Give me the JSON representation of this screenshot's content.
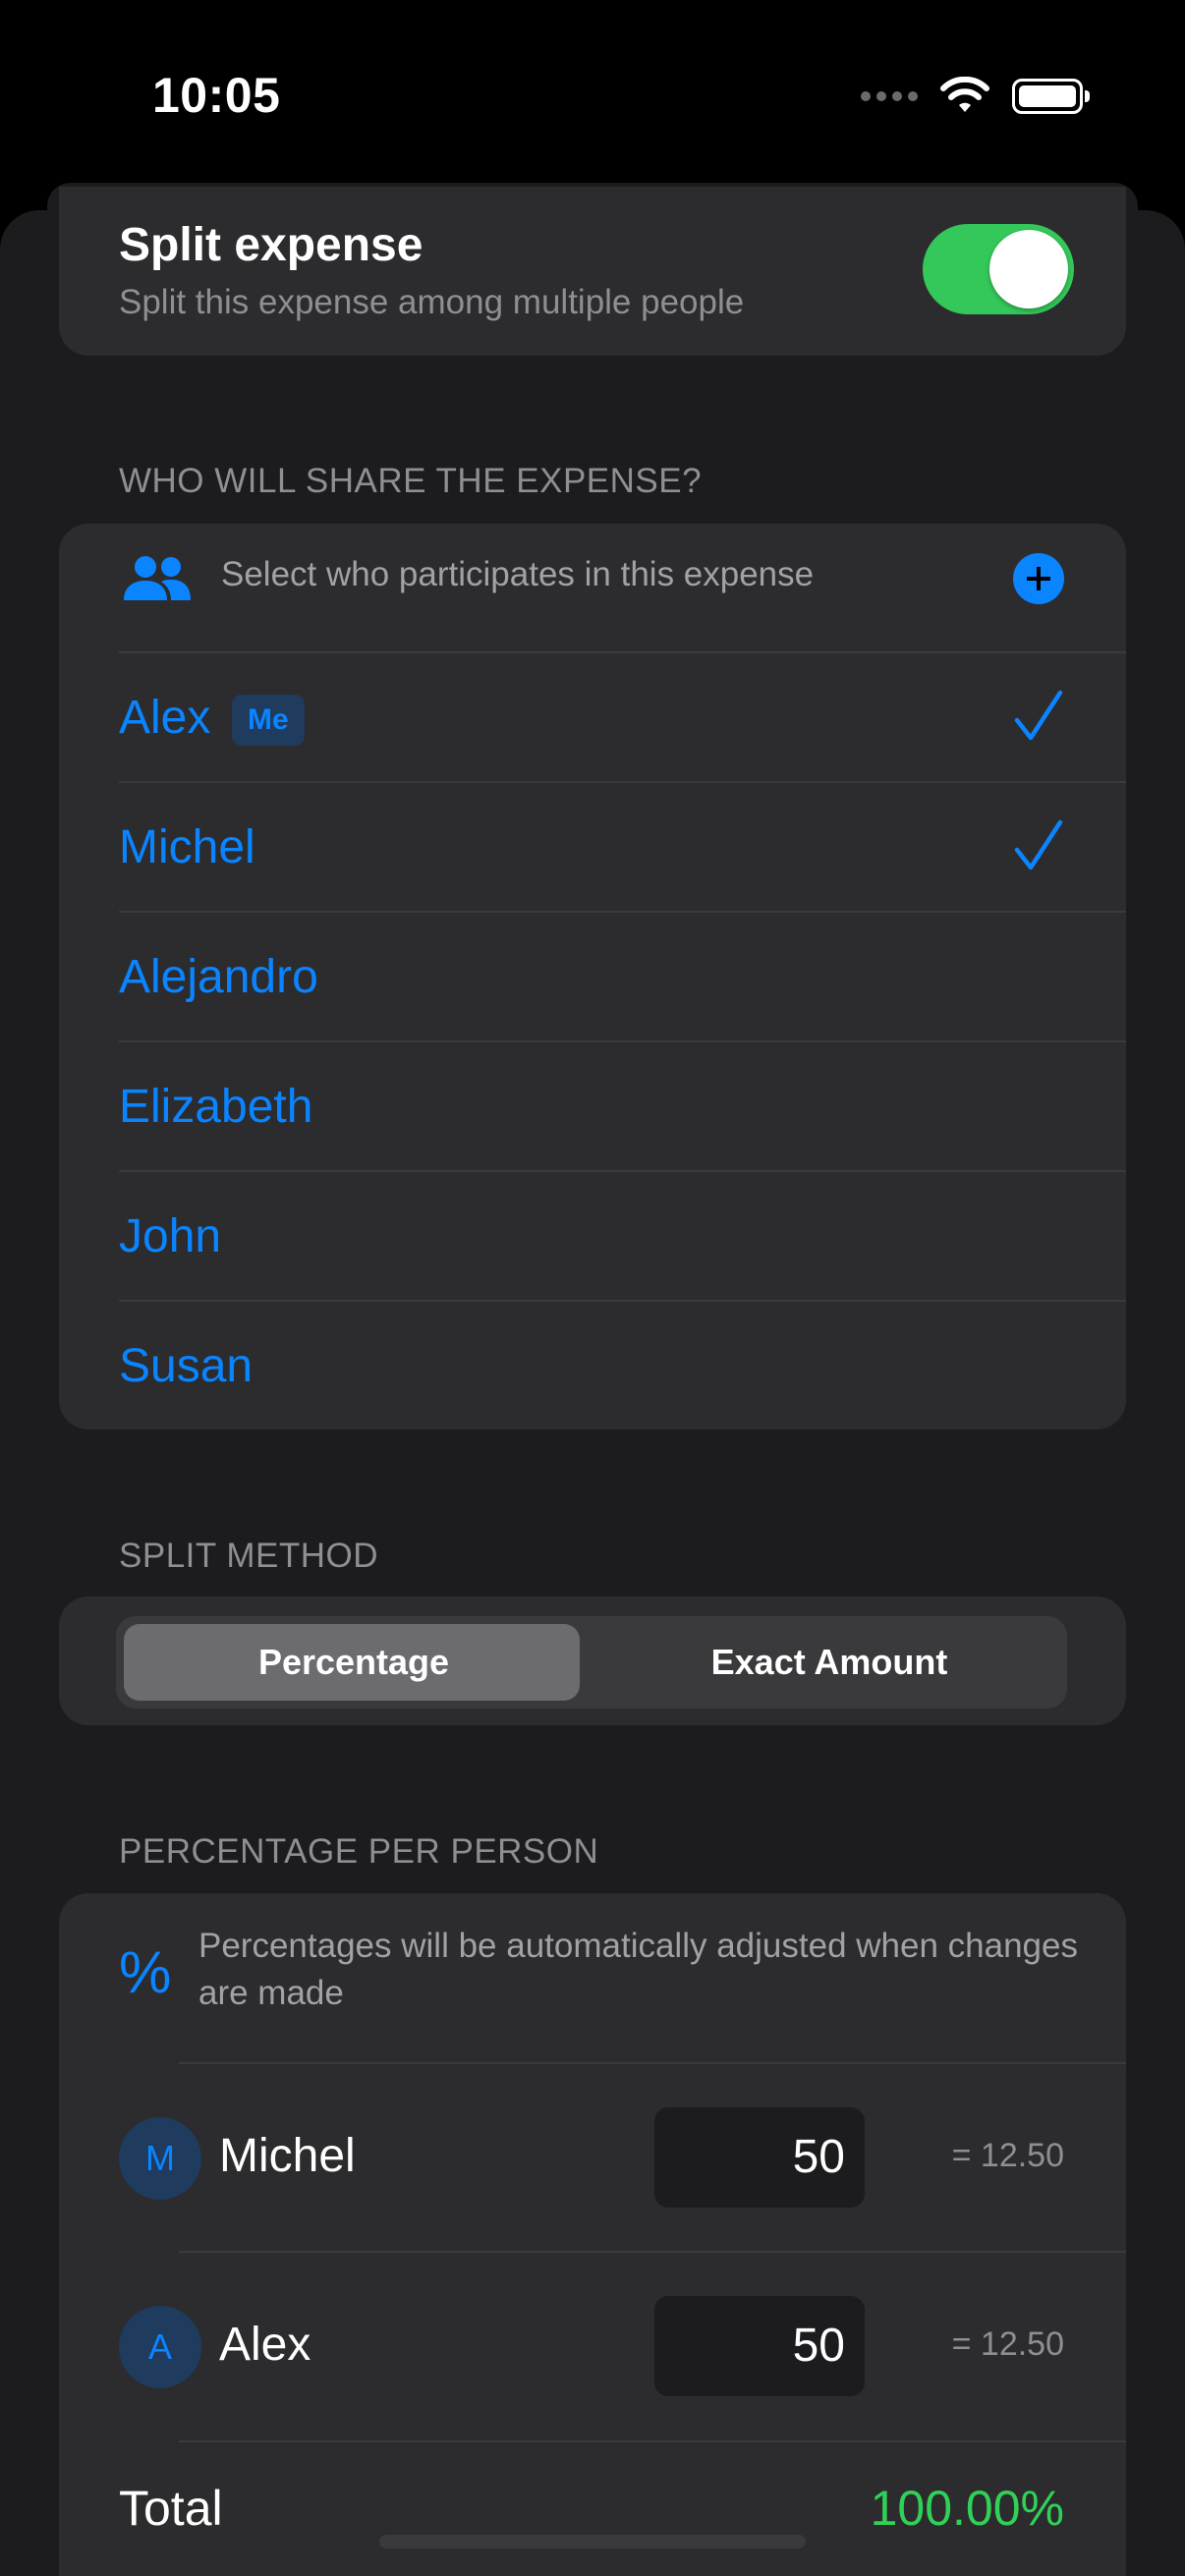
{
  "status_bar": {
    "time": "10:05"
  },
  "split_expense": {
    "title": "Split expense",
    "subtitle": "Split this expense among multiple people",
    "enabled": true
  },
  "share_section": {
    "header": "WHO WILL SHARE THE EXPENSE?",
    "instruction": "Select who participates in this expense",
    "people": [
      {
        "name": "Alex",
        "badge": "Me",
        "selected": true
      },
      {
        "name": "Michel",
        "selected": true
      },
      {
        "name": "Alejandro",
        "selected": false
      },
      {
        "name": "Elizabeth",
        "selected": false
      },
      {
        "name": "John",
        "selected": false
      },
      {
        "name": "Susan",
        "selected": false
      }
    ]
  },
  "method_section": {
    "header": "SPLIT METHOD",
    "options": [
      "Percentage",
      "Exact Amount"
    ],
    "selected": "Percentage"
  },
  "percentage_section": {
    "header": "PERCENTAGE PER PERSON",
    "info_icon": "%",
    "info": "Percentages will be automatically adjusted when changes are made",
    "rows": [
      {
        "initial": "M",
        "name": "Michel",
        "percent": "50",
        "amount": "= 12.50"
      },
      {
        "initial": "A",
        "name": "Alex",
        "percent": "50",
        "amount": "= 12.50"
      }
    ],
    "total_label": "Total",
    "total_value": "100.00%"
  },
  "colors": {
    "accent": "#0a84ff",
    "toggle_on": "#34c759",
    "total_ok": "#30d158",
    "background": "#1c1c1e",
    "card": "#2c2c2e"
  }
}
